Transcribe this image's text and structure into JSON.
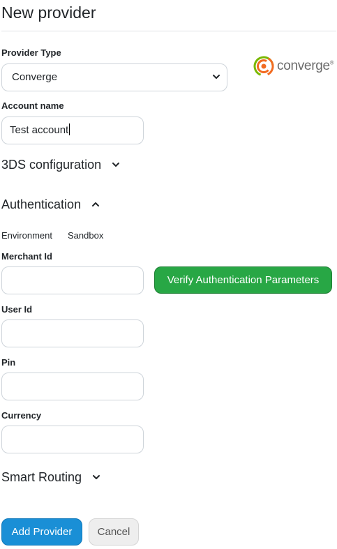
{
  "page": {
    "title": "New provider"
  },
  "provider_type": {
    "label": "Provider Type",
    "selected": "Converge",
    "logo_text": "converge",
    "logo_mark": "®"
  },
  "account_name": {
    "label": "Account name",
    "value": "Test account"
  },
  "sections": {
    "three_ds": {
      "label": "3DS configuration",
      "icon": "chevron-down-icon",
      "expanded": false
    },
    "authentication": {
      "label": "Authentication",
      "icon": "chevron-up-icon",
      "expanded": true
    },
    "smart_routing": {
      "label": "Smart Routing",
      "icon": "chevron-down-icon",
      "expanded": false
    }
  },
  "authentication": {
    "environment_label": "Environment",
    "environment_value": "Sandbox",
    "merchant_id": {
      "label": "Merchant Id",
      "value": ""
    },
    "user_id": {
      "label": "User Id",
      "value": ""
    },
    "pin": {
      "label": "Pin",
      "value": ""
    },
    "currency": {
      "label": "Currency",
      "value": ""
    },
    "verify_button": "Verify Authentication Parameters"
  },
  "actions": {
    "add": "Add Provider",
    "cancel": "Cancel"
  },
  "colors": {
    "verify_button": "#28a745",
    "add_button": "#1a8fd6",
    "cancel_button": "#eeeeee",
    "logo_ring_orange": "#f26b21",
    "logo_ring_green": "#7ab800"
  }
}
